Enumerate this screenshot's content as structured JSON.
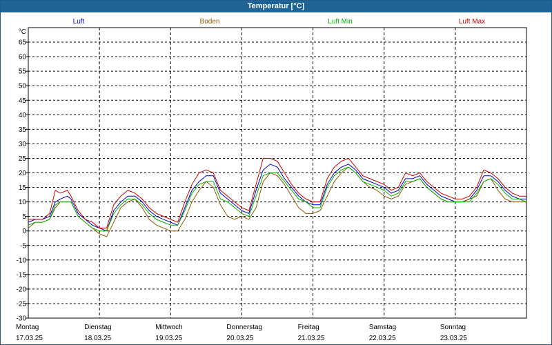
{
  "window": {
    "title": "Temperatur [°C]"
  },
  "colors": {
    "titlebar": "#1e6496",
    "luft": "#0000c8",
    "boden": "#8c5a00",
    "luft_min": "#00b400",
    "luft_max": "#c80000"
  },
  "chart_data": {
    "type": "line",
    "title": "Temperatur [°C]",
    "ylabel": "°C",
    "ylim": [
      -30,
      70
    ],
    "yticks": [
      -30,
      -25,
      -20,
      -15,
      -10,
      -5,
      0,
      5,
      10,
      15,
      20,
      25,
      30,
      35,
      40,
      45,
      50,
      55,
      60,
      65
    ],
    "xlim": [
      0,
      7
    ],
    "x_unit": "days since 17.03.25 00:00",
    "day_labels": [
      {
        "day": "Montag",
        "date": "17.03.25"
      },
      {
        "day": "Dienstag",
        "date": "18.03.25"
      },
      {
        "day": "Mittwoch",
        "date": "19.03.25"
      },
      {
        "day": "Donnerstag",
        "date": "20.03.25"
      },
      {
        "day": "Freitag",
        "date": "21.03.25"
      },
      {
        "day": "Samstag",
        "date": "22.03.25"
      },
      {
        "day": "Sonntag",
        "date": "23.03.25"
      }
    ],
    "grid": true,
    "legend_position": "top",
    "series": [
      {
        "name": "Luft",
        "color": "#0000c8",
        "points": [
          [
            0,
            3
          ],
          [
            0.1,
            4
          ],
          [
            0.2,
            4
          ],
          [
            0.3,
            5
          ],
          [
            0.38,
            10
          ],
          [
            0.45,
            11
          ],
          [
            0.55,
            12
          ],
          [
            0.6,
            11
          ],
          [
            0.7,
            6
          ],
          [
            0.8,
            4
          ],
          [
            0.9,
            2
          ],
          [
            1.0,
            1
          ],
          [
            1.1,
            0
          ],
          [
            1.2,
            7
          ],
          [
            1.3,
            10
          ],
          [
            1.4,
            12
          ],
          [
            1.5,
            12
          ],
          [
            1.6,
            10
          ],
          [
            1.7,
            7
          ],
          [
            1.8,
            5
          ],
          [
            1.9,
            4
          ],
          [
            2.0,
            3
          ],
          [
            2.1,
            2
          ],
          [
            2.2,
            8
          ],
          [
            2.3,
            14
          ],
          [
            2.4,
            17
          ],
          [
            2.5,
            19
          ],
          [
            2.6,
            19
          ],
          [
            2.7,
            13
          ],
          [
            2.8,
            11
          ],
          [
            2.9,
            9
          ],
          [
            3.0,
            7
          ],
          [
            3.1,
            6
          ],
          [
            3.2,
            14
          ],
          [
            3.3,
            21
          ],
          [
            3.4,
            23
          ],
          [
            3.5,
            22
          ],
          [
            3.6,
            18
          ],
          [
            3.7,
            15
          ],
          [
            3.8,
            12
          ],
          [
            3.9,
            10
          ],
          [
            4.0,
            9
          ],
          [
            4.1,
            9
          ],
          [
            4.2,
            16
          ],
          [
            4.3,
            20
          ],
          [
            4.4,
            22
          ],
          [
            4.5,
            23
          ],
          [
            4.6,
            21
          ],
          [
            4.7,
            18
          ],
          [
            4.8,
            17
          ],
          [
            4.9,
            16
          ],
          [
            5.0,
            15
          ],
          [
            5.1,
            13
          ],
          [
            5.2,
            14
          ],
          [
            5.3,
            18
          ],
          [
            5.4,
            18
          ],
          [
            5.5,
            19
          ],
          [
            5.6,
            16
          ],
          [
            5.7,
            14
          ],
          [
            5.8,
            12
          ],
          [
            5.9,
            11
          ],
          [
            6.0,
            10
          ],
          [
            6.1,
            10
          ],
          [
            6.2,
            11
          ],
          [
            6.3,
            14
          ],
          [
            6.4,
            19
          ],
          [
            6.5,
            19
          ],
          [
            6.6,
            17
          ],
          [
            6.7,
            14
          ],
          [
            6.8,
            12
          ],
          [
            6.9,
            11
          ],
          [
            7.0,
            11
          ]
        ]
      },
      {
        "name": "Boden",
        "color": "#8c5a00",
        "points": [
          [
            0,
            1
          ],
          [
            0.1,
            3
          ],
          [
            0.2,
            3
          ],
          [
            0.3,
            4
          ],
          [
            0.38,
            8
          ],
          [
            0.45,
            10
          ],
          [
            0.55,
            10
          ],
          [
            0.6,
            10
          ],
          [
            0.7,
            5
          ],
          [
            0.8,
            3
          ],
          [
            0.9,
            1
          ],
          [
            1.0,
            -1
          ],
          [
            1.1,
            -2
          ],
          [
            1.2,
            3
          ],
          [
            1.3,
            8
          ],
          [
            1.4,
            10
          ],
          [
            1.5,
            11
          ],
          [
            1.6,
            8
          ],
          [
            1.7,
            4
          ],
          [
            1.8,
            2
          ],
          [
            1.9,
            1
          ],
          [
            2.0,
            0
          ],
          [
            2.1,
            0
          ],
          [
            2.2,
            4
          ],
          [
            2.3,
            10
          ],
          [
            2.4,
            14
          ],
          [
            2.5,
            17
          ],
          [
            2.6,
            15
          ],
          [
            2.7,
            9
          ],
          [
            2.8,
            5
          ],
          [
            2.9,
            4
          ],
          [
            3.0,
            5
          ],
          [
            3.1,
            4
          ],
          [
            3.2,
            8
          ],
          [
            3.3,
            17
          ],
          [
            3.4,
            20
          ],
          [
            3.5,
            19
          ],
          [
            3.6,
            16
          ],
          [
            3.7,
            12
          ],
          [
            3.8,
            8
          ],
          [
            3.9,
            6
          ],
          [
            4.0,
            6
          ],
          [
            4.1,
            7
          ],
          [
            4.2,
            12
          ],
          [
            4.3,
            17
          ],
          [
            4.4,
            20
          ],
          [
            4.5,
            22
          ],
          [
            4.6,
            20
          ],
          [
            4.7,
            17
          ],
          [
            4.8,
            15
          ],
          [
            4.9,
            14
          ],
          [
            5.0,
            12
          ],
          [
            5.1,
            11
          ],
          [
            5.2,
            12
          ],
          [
            5.3,
            16
          ],
          [
            5.4,
            17
          ],
          [
            5.5,
            18
          ],
          [
            5.6,
            15
          ],
          [
            5.7,
            13
          ],
          [
            5.8,
            11
          ],
          [
            5.9,
            10
          ],
          [
            6.0,
            10
          ],
          [
            6.1,
            10
          ],
          [
            6.2,
            11
          ],
          [
            6.3,
            12
          ],
          [
            6.4,
            17
          ],
          [
            6.5,
            18
          ],
          [
            6.6,
            14
          ],
          [
            6.7,
            11
          ],
          [
            6.8,
            10
          ],
          [
            6.9,
            10
          ],
          [
            7.0,
            10
          ]
        ]
      },
      {
        "name": "Luft Min",
        "color": "#00b400",
        "points": [
          [
            0,
            2
          ],
          [
            0.1,
            3
          ],
          [
            0.2,
            3
          ],
          [
            0.3,
            4
          ],
          [
            0.38,
            9
          ],
          [
            0.45,
            10
          ],
          [
            0.55,
            10
          ],
          [
            0.6,
            10
          ],
          [
            0.7,
            5
          ],
          [
            0.8,
            3
          ],
          [
            0.9,
            1
          ],
          [
            1.0,
            0
          ],
          [
            1.1,
            0
          ],
          [
            1.2,
            6
          ],
          [
            1.3,
            9
          ],
          [
            1.4,
            11
          ],
          [
            1.5,
            11
          ],
          [
            1.6,
            9
          ],
          [
            1.7,
            6
          ],
          [
            1.8,
            4
          ],
          [
            1.9,
            3
          ],
          [
            2.0,
            2
          ],
          [
            2.1,
            2
          ],
          [
            2.2,
            7
          ],
          [
            2.3,
            13
          ],
          [
            2.4,
            16
          ],
          [
            2.5,
            17
          ],
          [
            2.6,
            17
          ],
          [
            2.7,
            11
          ],
          [
            2.8,
            10
          ],
          [
            2.9,
            8
          ],
          [
            3.0,
            6
          ],
          [
            3.1,
            5
          ],
          [
            3.2,
            12
          ],
          [
            3.3,
            19
          ],
          [
            3.4,
            20
          ],
          [
            3.5,
            20
          ],
          [
            3.6,
            17
          ],
          [
            3.7,
            14
          ],
          [
            3.8,
            11
          ],
          [
            3.9,
            10
          ],
          [
            4.0,
            8
          ],
          [
            4.1,
            8
          ],
          [
            4.2,
            15
          ],
          [
            4.3,
            19
          ],
          [
            4.4,
            21
          ],
          [
            4.5,
            22
          ],
          [
            4.6,
            20
          ],
          [
            4.7,
            17
          ],
          [
            4.8,
            16
          ],
          [
            4.9,
            15
          ],
          [
            5.0,
            14
          ],
          [
            5.1,
            12
          ],
          [
            5.2,
            13
          ],
          [
            5.3,
            17
          ],
          [
            5.4,
            17
          ],
          [
            5.5,
            18
          ],
          [
            5.6,
            15
          ],
          [
            5.7,
            13
          ],
          [
            5.8,
            11
          ],
          [
            5.9,
            10
          ],
          [
            6.0,
            10
          ],
          [
            6.1,
            10
          ],
          [
            6.2,
            10
          ],
          [
            6.3,
            13
          ],
          [
            6.4,
            17
          ],
          [
            6.5,
            18
          ],
          [
            6.6,
            16
          ],
          [
            6.7,
            13
          ],
          [
            6.8,
            11
          ],
          [
            6.9,
            11
          ],
          [
            7.0,
            10
          ]
        ]
      },
      {
        "name": "Luft Max",
        "color": "#c80000",
        "points": [
          [
            0,
            4
          ],
          [
            0.1,
            4
          ],
          [
            0.2,
            4
          ],
          [
            0.3,
            6
          ],
          [
            0.38,
            14
          ],
          [
            0.45,
            13
          ],
          [
            0.55,
            14
          ],
          [
            0.6,
            12
          ],
          [
            0.7,
            7
          ],
          [
            0.8,
            4
          ],
          [
            0.9,
            3
          ],
          [
            1.0,
            1
          ],
          [
            1.1,
            1
          ],
          [
            1.2,
            9
          ],
          [
            1.3,
            12
          ],
          [
            1.4,
            14
          ],
          [
            1.5,
            13
          ],
          [
            1.6,
            11
          ],
          [
            1.7,
            8
          ],
          [
            1.8,
            6
          ],
          [
            1.9,
            5
          ],
          [
            2.0,
            4
          ],
          [
            2.1,
            3
          ],
          [
            2.2,
            10
          ],
          [
            2.3,
            16
          ],
          [
            2.4,
            20
          ],
          [
            2.5,
            21
          ],
          [
            2.6,
            20
          ],
          [
            2.7,
            14
          ],
          [
            2.8,
            12
          ],
          [
            2.9,
            10
          ],
          [
            3.0,
            8
          ],
          [
            3.1,
            7
          ],
          [
            3.2,
            16
          ],
          [
            3.3,
            25
          ],
          [
            3.4,
            25
          ],
          [
            3.5,
            24
          ],
          [
            3.6,
            20
          ],
          [
            3.7,
            16
          ],
          [
            3.8,
            13
          ],
          [
            3.9,
            11
          ],
          [
            4.0,
            10
          ],
          [
            4.1,
            10
          ],
          [
            4.2,
            18
          ],
          [
            4.3,
            22
          ],
          [
            4.4,
            24
          ],
          [
            4.5,
            25
          ],
          [
            4.6,
            22
          ],
          [
            4.7,
            19
          ],
          [
            4.8,
            18
          ],
          [
            4.9,
            17
          ],
          [
            5.0,
            16
          ],
          [
            5.1,
            14
          ],
          [
            5.2,
            15
          ],
          [
            5.3,
            20
          ],
          [
            5.4,
            19
          ],
          [
            5.5,
            20
          ],
          [
            5.6,
            17
          ],
          [
            5.7,
            15
          ],
          [
            5.8,
            13
          ],
          [
            5.9,
            12
          ],
          [
            6.0,
            11
          ],
          [
            6.1,
            11
          ],
          [
            6.2,
            12
          ],
          [
            6.3,
            15
          ],
          [
            6.4,
            21
          ],
          [
            6.5,
            20
          ],
          [
            6.6,
            18
          ],
          [
            6.7,
            15
          ],
          [
            6.8,
            13
          ],
          [
            6.9,
            12
          ],
          [
            7.0,
            12
          ]
        ]
      }
    ]
  }
}
